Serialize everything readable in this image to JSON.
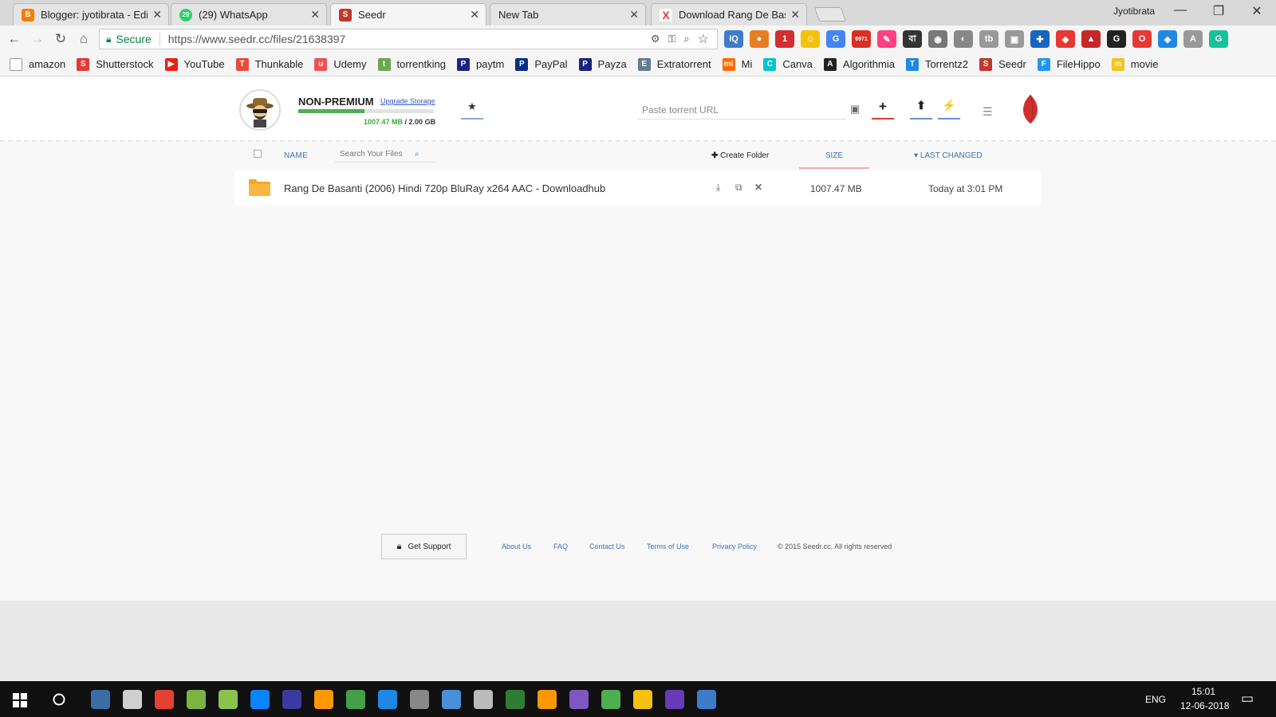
{
  "browser": {
    "tabs": [
      {
        "title": "Blogger: jyotibrata - Edit",
        "color": "#f57d00",
        "glyph": "B"
      },
      {
        "title": "(29) WhatsApp",
        "color": "#25d366",
        "glyph": "29"
      },
      {
        "title": "Seedr",
        "color": "#c0392b",
        "glyph": "S"
      },
      {
        "title": "New Tab",
        "color": "",
        "glyph": ""
      },
      {
        "title": "Download Rang De Basanti",
        "color": "#e53935",
        "glyph": "X"
      }
    ],
    "profile_name": "Jyotibrata",
    "secure_label": "Secure",
    "url": "https://www.seedr.cc/files/21638397",
    "bookmarks": [
      {
        "label": "amazon",
        "color": "#ffffff",
        "glyph": ""
      },
      {
        "label": "Shutterstock",
        "color": "#e53935",
        "glyph": "S"
      },
      {
        "label": "YouTube",
        "color": "#e62117",
        "glyph": "▶"
      },
      {
        "label": "Thunkable",
        "color": "#e84a3c",
        "glyph": "T"
      },
      {
        "label": "Udemy",
        "color": "#ec5252",
        "glyph": "u"
      },
      {
        "label": "torrentking",
        "color": "#6aa84f",
        "glyph": "t"
      },
      {
        "label": "paytm",
        "color": "#1a237e",
        "glyph": "P"
      },
      {
        "label": "PayPal",
        "color": "#003087",
        "glyph": "P"
      },
      {
        "label": "Payza",
        "color": "#1a237e",
        "glyph": "P"
      },
      {
        "label": "Extratorrent",
        "color": "#607d8b",
        "glyph": "E"
      },
      {
        "label": "Mi",
        "color": "#ff6700",
        "glyph": "mi"
      },
      {
        "label": "Canva",
        "color": "#00c4cc",
        "glyph": "C"
      },
      {
        "label": "Algorithmia",
        "color": "#222222",
        "glyph": "A"
      },
      {
        "label": "Torrentz2",
        "color": "#1e88e5",
        "glyph": "T"
      },
      {
        "label": "Seedr",
        "color": "#c0392b",
        "glyph": "S"
      },
      {
        "label": "FileHippo",
        "color": "#2196f3",
        "glyph": "F"
      },
      {
        "label": "movie",
        "color": "#f5c518",
        "glyph": "m"
      }
    ],
    "extensions": [
      {
        "name": "iq-icon",
        "color": "#3d7cc9",
        "glyph": "IQ"
      },
      {
        "name": "basketball-icon",
        "color": "#e67e22",
        "glyph": "●"
      },
      {
        "name": "calendar-icon",
        "color": "#d32f2f",
        "glyph": "1"
      },
      {
        "name": "emoji-icon",
        "color": "#f4c20d",
        "glyph": "☺"
      },
      {
        "name": "translate-icon",
        "color": "#4285f4",
        "glyph": "G"
      },
      {
        "name": "gmail-icon",
        "color": "#d93025",
        "glyph": "6971"
      },
      {
        "name": "feather-icon",
        "color": "#ff4081",
        "glyph": "✎"
      },
      {
        "name": "bengali-icon",
        "color": "#333333",
        "glyph": "বা"
      },
      {
        "name": "bulb-icon",
        "color": "#777777",
        "glyph": "◉"
      },
      {
        "name": "camera-icon",
        "color": "#888888",
        "glyph": "◐"
      },
      {
        "name": "tb-icon",
        "color": "#999999",
        "glyph": "tb"
      },
      {
        "name": "cart-icon",
        "color": "#999999",
        "glyph": "▣"
      },
      {
        "name": "plus-circle-icon",
        "color": "#1565c0",
        "glyph": "✚"
      },
      {
        "name": "tag-icon",
        "color": "#e53935",
        "glyph": "◆"
      },
      {
        "name": "chart-icon",
        "color": "#c62828",
        "glyph": "▲"
      },
      {
        "name": "grammarly-icon",
        "color": "#222222",
        "glyph": "G"
      },
      {
        "name": "opera-icon",
        "color": "#e53935",
        "glyph": "O"
      },
      {
        "name": "shield-icon",
        "color": "#1e88e5",
        "glyph": "◈"
      },
      {
        "name": "puzzle-icon",
        "color": "#999999",
        "glyph": "A"
      },
      {
        "name": "grammar-icon",
        "color": "#15c39a",
        "glyph": "G"
      }
    ]
  },
  "seedr": {
    "plan": "NON-PREMIUM",
    "upgrade_label": "Upgrade Storage",
    "storage_used": "1007.47 MB",
    "storage_total": "/ 2.00 GB",
    "storage_fraction": 0.49,
    "torrent_placeholder": "Paste torrent URL",
    "add_glyph": "+",
    "upload_glyph": "⬆",
    "flash_glyph": "⚡",
    "menu_glyph": "☰",
    "star_glyph": "★"
  },
  "files": {
    "columns": {
      "name": "NAME",
      "search_placeholder": "Search Your Files",
      "create_folder": "Create Folder",
      "size": "SIZE",
      "changed": "LAST CHANGED"
    },
    "rows": [
      {
        "name": "Rang De Basanti (2006) Hindi 720p BluRay x264 AAC - Downloadhub",
        "size": "1007.47 MB",
        "changed": "Today at 3:01 PM"
      }
    ]
  },
  "footer": {
    "support": "Get Support",
    "links": [
      "About Us",
      "FAQ",
      "Contact Us",
      "Terms of Use",
      "Privacy Policy"
    ],
    "copyright": "© 2015 Seedr.cc, All rights reserved"
  },
  "taskbar": {
    "language": "ENG",
    "time": "15:01",
    "date": "12-06-2018"
  },
  "colors": {
    "accent_blue": "#3f6fb8",
    "storage_green": "#4caf50",
    "accent_red": "#e53935"
  }
}
